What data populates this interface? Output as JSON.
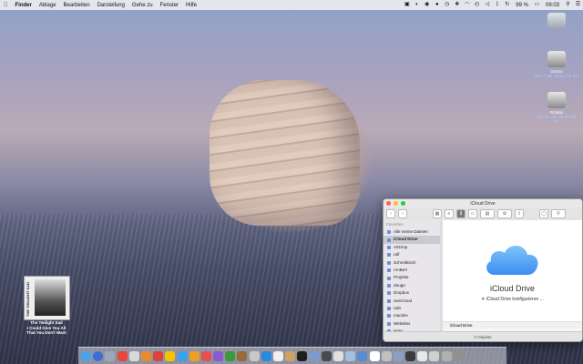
{
  "menubar": {
    "apple": "",
    "app": "Finder",
    "menus": [
      "Ablage",
      "Bearbeiten",
      "Darstellung",
      "Gehe zu",
      "Fenster",
      "Hilfe"
    ],
    "battery": "99 %",
    "time": "09:03"
  },
  "desktop_icons": [
    {
      "name": "Gonzo",
      "detail": "352,2 GB, 60,09 GB frei"
    },
    {
      "name": "Rotatio",
      "detail": "354,91 GB, 60,09 GB frei"
    }
  ],
  "album": {
    "spine": "THE TWILIGHT SAD",
    "caption_line1": "The Twilight Sad",
    "caption_line2": "I Could Give You All",
    "caption_line3": "That You Don't Want"
  },
  "finder": {
    "title": "iCloud Drive",
    "sidebar_header": "Favoriten",
    "sidebar_items": [
      "Alle meine Dateien",
      "iCloud Drive",
      "AirDrop",
      "ralf",
      "Schreibtisch",
      "AmBert",
      "Projekte",
      "Zeuge",
      "Dropbox",
      "ownCloud",
      "rails",
      "macdev",
      "Websites",
      "www"
    ],
    "selected_item": "iCloud Drive",
    "content_title": "iCloud Drive",
    "content_status": "iCloud Drive konfigurieren ...",
    "path": "iCloud Drive",
    "status": "0 Objekte"
  },
  "dock_colors": [
    "#4aa3e8",
    "#3b6fd8",
    "#9aa7b8",
    "#e8473c",
    "#d9d9d9",
    "#e98b2a",
    "#e04040",
    "#f5c400",
    "#3aa0f0",
    "#f0a020",
    "#e85050",
    "#8a5ad0",
    "#3c9a3c",
    "#9a6a3a",
    "#c8c8c8",
    "#2a8adf",
    "#f0f0f0",
    "#d0a060",
    "#1e1e1e",
    "#7a9ad0",
    "#4a4a4a",
    "#e0e0e0",
    "#a0c0e0",
    "#5a8ad0",
    "#ffffff",
    "#c0c0c0",
    "#8aa0c0",
    "#3a3a3a",
    "#e8e8e8",
    "#d0d0d0",
    "#b0b0b0",
    "#909090"
  ]
}
